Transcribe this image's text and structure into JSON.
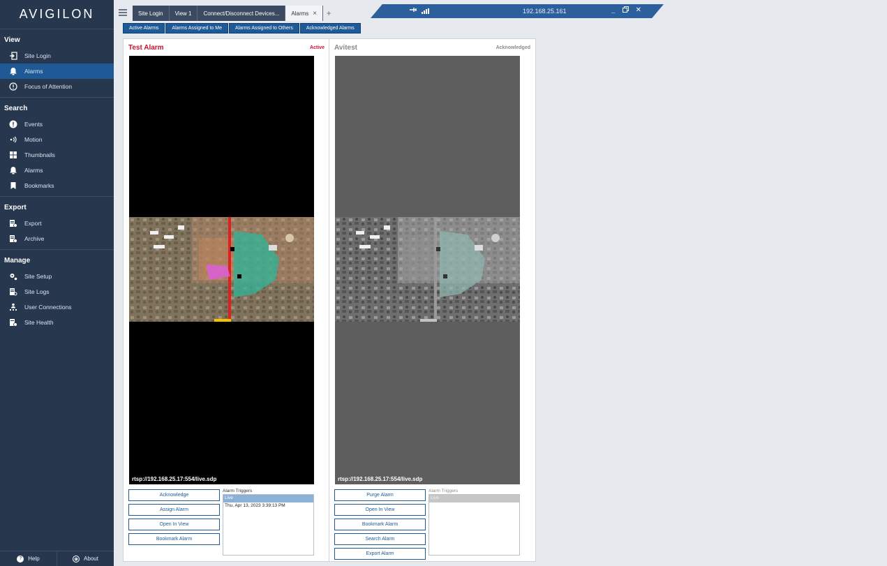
{
  "app": {
    "logo_text": "AVIGILON"
  },
  "sidebar": {
    "sections": [
      {
        "title": "View",
        "items": [
          {
            "label": "Site Login",
            "icon": "login-icon"
          },
          {
            "label": "Alarms",
            "icon": "bell-icon",
            "active": true
          },
          {
            "label": "Focus of Attention",
            "icon": "exclamation-circle-icon"
          }
        ]
      },
      {
        "title": "Search",
        "items": [
          {
            "label": "Events",
            "icon": "exclamation-icon"
          },
          {
            "label": "Motion",
            "icon": "motion-icon"
          },
          {
            "label": "Thumbnails",
            "icon": "grid-icon"
          },
          {
            "label": "Alarms",
            "icon": "bell-icon"
          },
          {
            "label": "Bookmarks",
            "icon": "bookmark-icon"
          }
        ]
      },
      {
        "title": "Export",
        "items": [
          {
            "label": "Export",
            "icon": "export-icon"
          },
          {
            "label": "Archive",
            "icon": "archive-icon"
          }
        ]
      },
      {
        "title": "Manage",
        "items": [
          {
            "label": "Site Setup",
            "icon": "gears-icon"
          },
          {
            "label": "Site Logs",
            "icon": "logs-icon"
          },
          {
            "label": "User Connections",
            "icon": "user-connections-icon"
          },
          {
            "label": "Site Health",
            "icon": "health-icon"
          }
        ]
      }
    ],
    "footer": {
      "help": "Help",
      "about": "About"
    }
  },
  "tabs": [
    {
      "label": "Site Login"
    },
    {
      "label": "View 1"
    },
    {
      "label": "Connect/Disconnect Devices..."
    },
    {
      "label": "Alarms",
      "active": true,
      "close": "×"
    }
  ],
  "connection": {
    "ip": "192.168.25.161",
    "icons": [
      "pin-icon",
      "signal-icon"
    ],
    "window_controls": [
      "minimize-icon",
      "restore-icon",
      "close-icon"
    ]
  },
  "filters": [
    "Active Alarms",
    "Alarms Assigned to Me",
    "Alarms Assigned to Others",
    "Acknowledged Alarms"
  ],
  "alarms": [
    {
      "title": "Test Alarm",
      "status": "Active",
      "title_color": "#c8102e",
      "status_color": "#c8102e",
      "stream": "rtsp://192.168.25.17:554/live.sdp",
      "buttons": [
        "Acknowledge",
        "Assign Alarm",
        "Open In View",
        "Bookmark Alarm"
      ],
      "triggers_label": "Alarm Triggers",
      "triggers": [
        "Live",
        "Thu, Apr 13, 2023 3:39:13 PM"
      ]
    },
    {
      "title": "Avitest",
      "status": "Acknowledged",
      "title_color": "#8a8a8a",
      "status_color": "#8a8a8a",
      "stream": "rtsp://192.168.25.17:554/live.sdp",
      "buttons": [
        "Purge Alarm",
        "Open In View",
        "Bookmark Alarm",
        "Search Alarm",
        "Export Alarm"
      ],
      "triggers_label": "Alarm Triggers",
      "triggers": [
        "Live"
      ]
    }
  ]
}
